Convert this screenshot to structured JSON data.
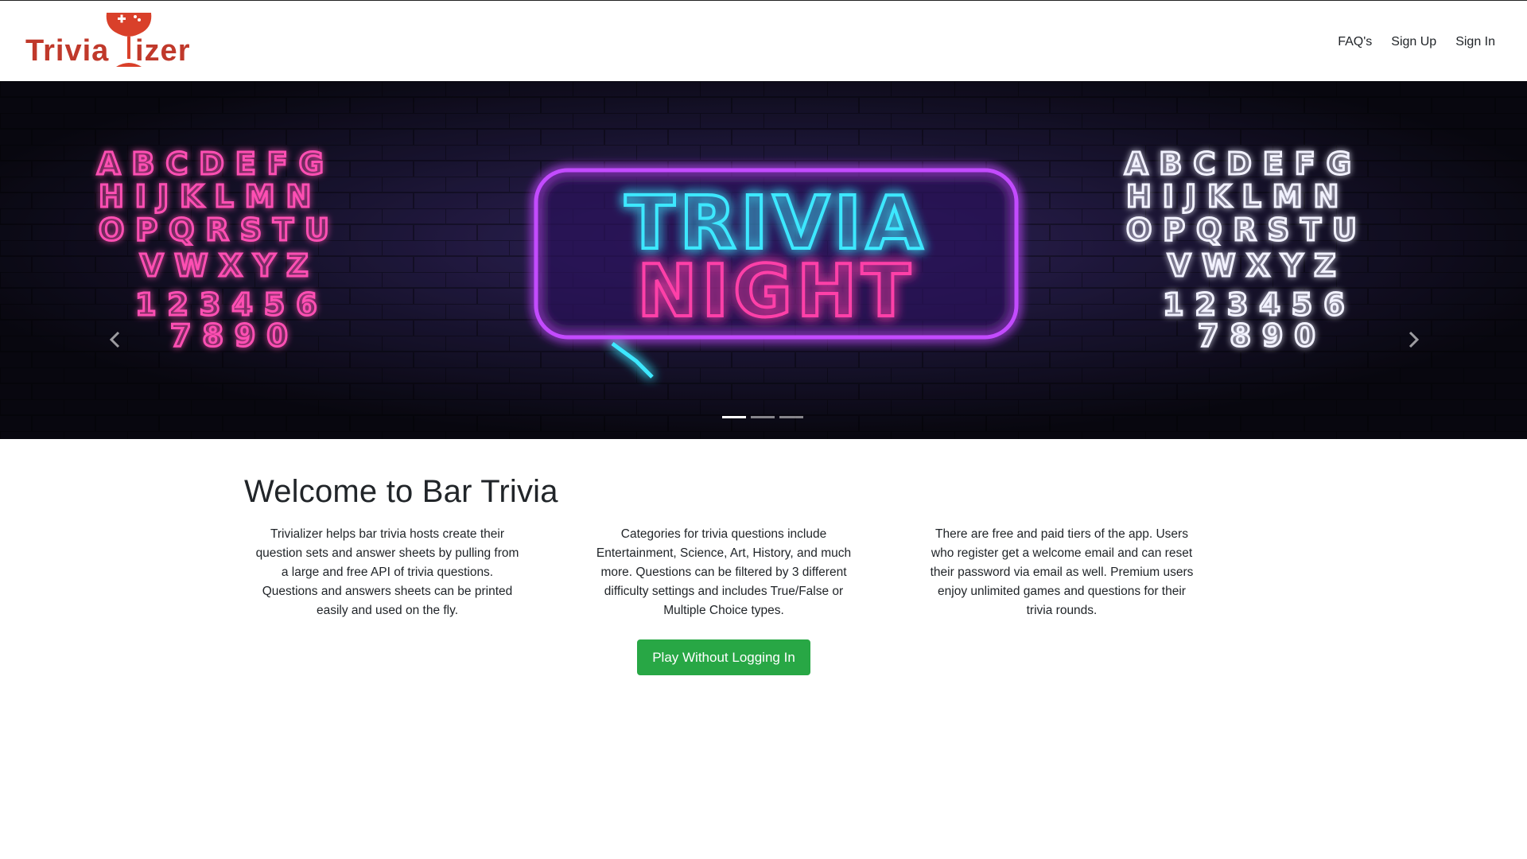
{
  "header": {
    "brand_name": "Triviaᴉizer",
    "logo_icon": "wine-glass-gamepad-logo",
    "nav": [
      {
        "label": "FAQ's"
      },
      {
        "label": "Sign Up"
      },
      {
        "label": "Sign In"
      }
    ]
  },
  "carousel": {
    "left_letters_rows": [
      "ABCDEFG",
      "HIJKLMN",
      "OPQRSTU",
      "VWXYZ",
      "123456",
      "7890"
    ],
    "right_letters_rows": [
      "ABCDEFG",
      "HIJKLMN",
      "OPQRSTU",
      "VWXYZ",
      "123456",
      "7890"
    ],
    "sign_line1": "TRIVIA",
    "sign_line2": "NIGHT",
    "prev_icon": "chevron-left-icon",
    "next_icon": "chevron-right-icon",
    "slide_count": 3,
    "active_slide": 1
  },
  "main": {
    "title": "Welcome to Bar Trivia",
    "columns": [
      {
        "text": "Trivializer helps bar trivia hosts create their question sets and answer sheets by pulling from a large and free API of trivia questions. Questions and answers sheets can be printed easily and used on the fly."
      },
      {
        "text": "Categories for trivia questions include Entertainment, Science, Art, History, and much more. Questions can be filtered by 3 different difficulty settings and includes True/False or Multiple Choice types."
      },
      {
        "text": "There are free and paid tiers of the app. Users who register get a welcome email and can reset their password via email as well. Premium users enjoy unlimited games and questions for their trivia rounds."
      }
    ],
    "play_button": "Play Without Logging In"
  },
  "colors": {
    "brand_red": "#c0392b",
    "neon_pink": "#ff3fa8",
    "neon_cyan": "#3ee8ff",
    "neon_purple": "#b23cff",
    "button_green": "#28a745"
  }
}
